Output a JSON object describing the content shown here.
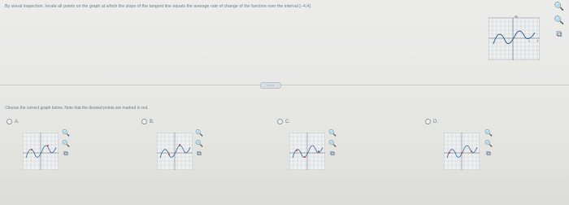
{
  "question": {
    "text": "By visual inspection, locate all points on the graph at which the slope of the tangent line equals the average rate of change of the function over the interval [−4,4]."
  },
  "main_graph": {
    "y_axis_label": "Ay",
    "x_axis_label": "x",
    "tick_label": "4"
  },
  "tools": {
    "zoom_in": "🔍",
    "zoom_out": "🔍",
    "external": "⧉"
  },
  "divider": {
    "handle": "•••••"
  },
  "answer": {
    "instruction": "Choose the correct graph below. Note that the desired points are marked in red.",
    "options": [
      {
        "label": "A."
      },
      {
        "label": "B."
      },
      {
        "label": "C."
      },
      {
        "label": "D."
      }
    ]
  },
  "colors": {
    "accent": "#2a6fb0",
    "marker": "#d23b3b",
    "grid": "#a9b4bd",
    "curve": "#2e5f95"
  }
}
